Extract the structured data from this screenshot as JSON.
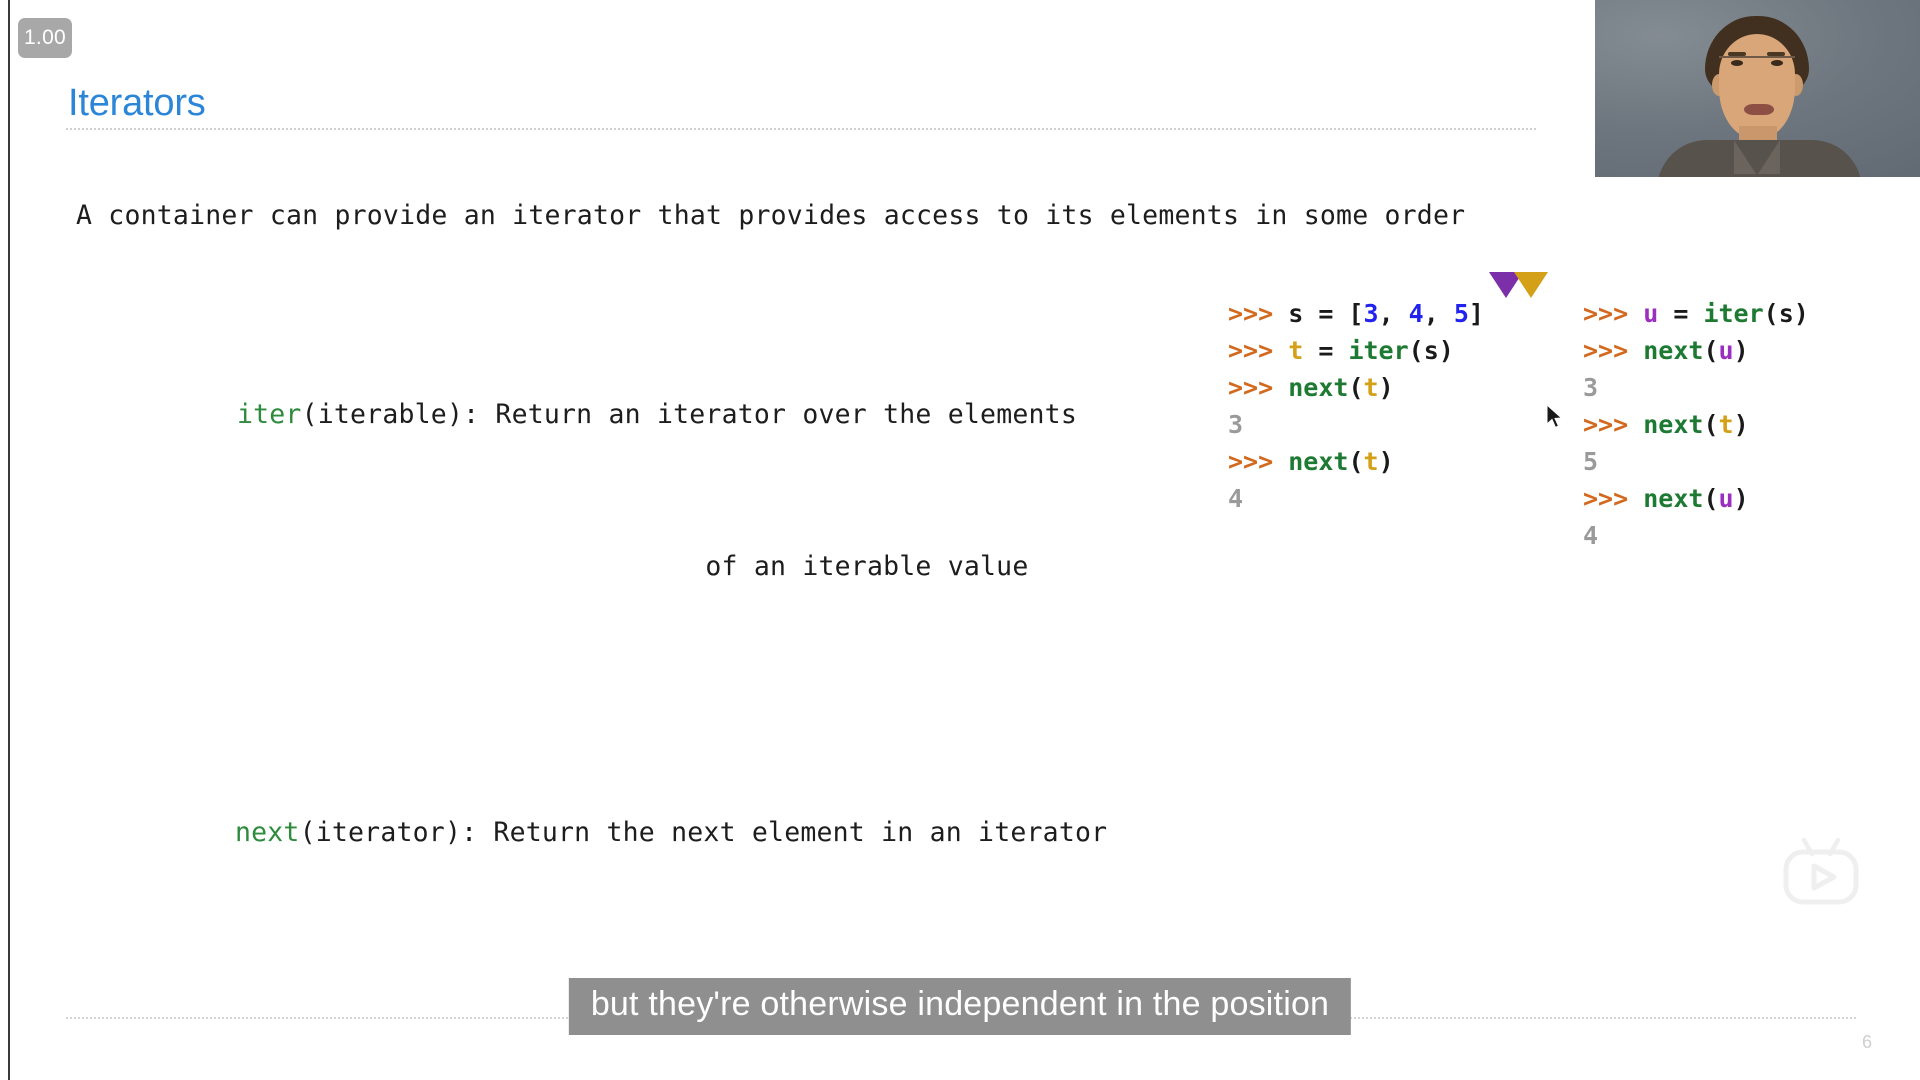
{
  "player": {
    "speed_badge": "1.00",
    "watermark_icon": "tv-play-icon"
  },
  "slide": {
    "title": "Iterators",
    "page_number": "6",
    "lead_line": "A container can provide an iterator that provides access to its elements in some order",
    "definitions": [
      {
        "fn": "iter",
        "signature": "(iterable): Return an iterator over the elements",
        "continuation": "of an iterable value"
      },
      {
        "fn": "next",
        "signature": "(iterator): Return the next element in an iterator",
        "continuation": ""
      }
    ]
  },
  "code_left": {
    "lines": [
      {
        "prompt": ">>> ",
        "tokens": [
          {
            "t": "s",
            "c": "var-s"
          },
          {
            "t": " = [",
            "c": "punct"
          },
          {
            "t": "3",
            "c": "num"
          },
          {
            "t": ", ",
            "c": "punct"
          },
          {
            "t": "4",
            "c": "num"
          },
          {
            "t": ", ",
            "c": "punct"
          },
          {
            "t": "5",
            "c": "num"
          },
          {
            "t": "]",
            "c": "punct"
          }
        ]
      },
      {
        "prompt": ">>> ",
        "tokens": [
          {
            "t": "t",
            "c": "var-t"
          },
          {
            "t": " = ",
            "c": "punct"
          },
          {
            "t": "iter",
            "c": "fnname"
          },
          {
            "t": "(",
            "c": "punct"
          },
          {
            "t": "s",
            "c": "var-s"
          },
          {
            "t": ")",
            "c": "punct"
          }
        ]
      },
      {
        "prompt": ">>> ",
        "tokens": [
          {
            "t": "next",
            "c": "fnname"
          },
          {
            "t": "(",
            "c": "punct"
          },
          {
            "t": "t",
            "c": "var-t"
          },
          {
            "t": ")",
            "c": "punct"
          }
        ]
      },
      {
        "prompt": "",
        "tokens": [
          {
            "t": "3",
            "c": "out"
          }
        ]
      },
      {
        "prompt": ">>> ",
        "tokens": [
          {
            "t": "next",
            "c": "fnname"
          },
          {
            "t": "(",
            "c": "punct"
          },
          {
            "t": "t",
            "c": "var-t"
          },
          {
            "t": ")",
            "c": "punct"
          }
        ]
      },
      {
        "prompt": "",
        "tokens": [
          {
            "t": "4",
            "c": "out"
          }
        ]
      }
    ]
  },
  "code_right": {
    "lines": [
      {
        "prompt": ">>> ",
        "tokens": [
          {
            "t": "u",
            "c": "var-u"
          },
          {
            "t": " = ",
            "c": "punct"
          },
          {
            "t": "iter",
            "c": "fnname"
          },
          {
            "t": "(",
            "c": "punct"
          },
          {
            "t": "s",
            "c": "var-s"
          },
          {
            "t": ")",
            "c": "punct"
          }
        ]
      },
      {
        "prompt": ">>> ",
        "tokens": [
          {
            "t": "next",
            "c": "fnname"
          },
          {
            "t": "(",
            "c": "punct"
          },
          {
            "t": "u",
            "c": "var-u"
          },
          {
            "t": ")",
            "c": "punct"
          }
        ]
      },
      {
        "prompt": "",
        "tokens": [
          {
            "t": "3",
            "c": "out"
          }
        ]
      },
      {
        "prompt": ">>> ",
        "tokens": [
          {
            "t": "next",
            "c": "fnname"
          },
          {
            "t": "(",
            "c": "punct"
          },
          {
            "t": "t",
            "c": "var-t"
          },
          {
            "t": ")",
            "c": "punct"
          }
        ]
      },
      {
        "prompt": "",
        "tokens": [
          {
            "t": "5",
            "c": "out"
          }
        ]
      },
      {
        "prompt": ">>> ",
        "tokens": [
          {
            "t": "next",
            "c": "fnname"
          },
          {
            "t": "(",
            "c": "punct"
          },
          {
            "t": "u",
            "c": "var-u"
          },
          {
            "t": ")",
            "c": "punct"
          }
        ]
      },
      {
        "prompt": "",
        "tokens": [
          {
            "t": "4",
            "c": "out"
          }
        ]
      }
    ]
  },
  "pointers": [
    {
      "name": "pointer-u",
      "color": "#7b2fa8",
      "label": "u"
    },
    {
      "name": "pointer-t",
      "color": "#d4a017",
      "label": "t"
    }
  ],
  "caption": {
    "text": "but they're otherwise independent in the position"
  },
  "colors": {
    "title_blue": "#2c86d8",
    "prompt_orange": "#d2691e",
    "fn_green": "#1e7a33",
    "num_blue": "#2222ee",
    "var_t_gold": "#d4a017",
    "var_u_purple": "#9b30c0",
    "output_gray": "#9a9a9a",
    "caption_bg": "#8f8f8f"
  }
}
